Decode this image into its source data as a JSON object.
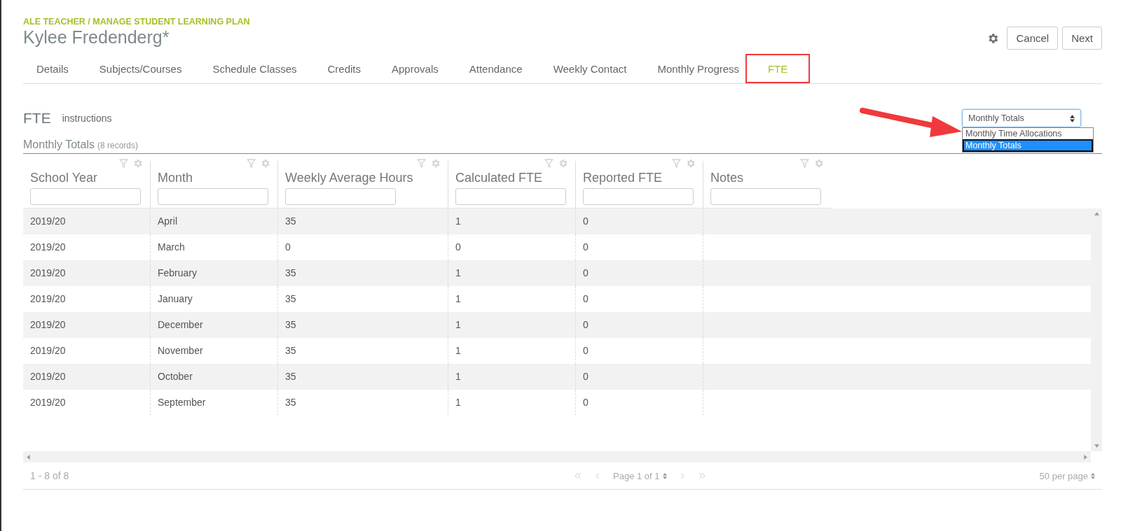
{
  "header": {
    "breadcrumb": "ALE TEACHER / MANAGE STUDENT LEARNING PLAN",
    "title": "Kylee Fredenderg*",
    "buttons": [
      "Cancel",
      "Next"
    ]
  },
  "tabs": [
    {
      "label": "Details",
      "selected": false
    },
    {
      "label": "Subjects/Courses",
      "selected": false
    },
    {
      "label": "Schedule Classes",
      "selected": false
    },
    {
      "label": "Credits",
      "selected": false
    },
    {
      "label": "Approvals",
      "selected": false
    },
    {
      "label": "Attendance",
      "selected": false
    },
    {
      "label": "Weekly Contact",
      "selected": false
    },
    {
      "label": "Monthly Progress",
      "selected": false
    },
    {
      "label": "FTE",
      "selected": true
    }
  ],
  "section": {
    "title": "FTE",
    "link": "instructions",
    "view_select": {
      "value": "Monthly Totals",
      "options": [
        {
          "label": "Monthly Time Allocations",
          "selected": false
        },
        {
          "label": "Monthly Totals",
          "selected": true
        }
      ]
    }
  },
  "grid": {
    "title": "Monthly Totals",
    "count": "(8 records)",
    "columns": [
      "School Year",
      "Month",
      "Weekly Average Hours",
      "Calculated FTE",
      "Reported FTE",
      "Notes"
    ],
    "rows": [
      [
        "2019/20",
        "April",
        "35",
        "1",
        "0",
        ""
      ],
      [
        "2019/20",
        "March",
        "0",
        "0",
        "0",
        ""
      ],
      [
        "2019/20",
        "February",
        "35",
        "1",
        "0",
        ""
      ],
      [
        "2019/20",
        "January",
        "35",
        "1",
        "0",
        ""
      ],
      [
        "2019/20",
        "December",
        "35",
        "1",
        "0",
        ""
      ],
      [
        "2019/20",
        "November",
        "35",
        "1",
        "0",
        ""
      ],
      [
        "2019/20",
        "October",
        "35",
        "1",
        "0",
        ""
      ],
      [
        "2019/20",
        "September",
        "35",
        "1",
        "0",
        ""
      ]
    ]
  },
  "pager": {
    "range": "1 - 8 of 8",
    "page": "Page 1 of 1",
    "per_page": "50 per page"
  }
}
